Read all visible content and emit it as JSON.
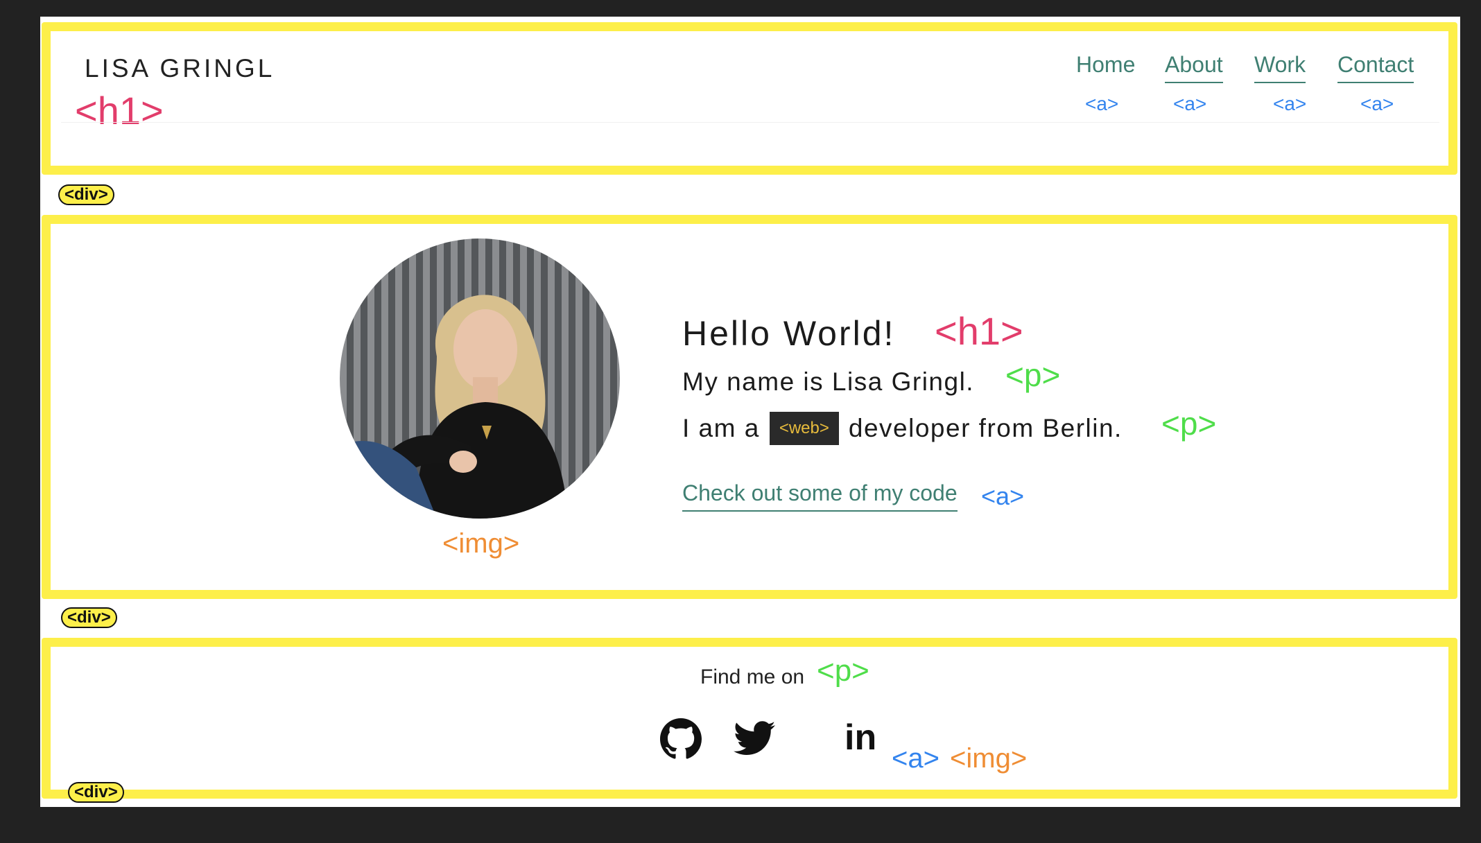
{
  "header": {
    "logo": "LISA GRINGL",
    "nav": [
      {
        "label": "Home"
      },
      {
        "label": "About"
      },
      {
        "label": "Work"
      },
      {
        "label": "Contact"
      }
    ]
  },
  "hero": {
    "heading": "Hello World!",
    "intro": "My name is Lisa Gringl.",
    "role_prefix": "I am a",
    "role_badge": "<web>",
    "role_suffix": "developer from Berlin.",
    "code_link": "Check out some of my code"
  },
  "footer": {
    "find_me": "Find me on",
    "social": [
      {
        "name": "github-icon"
      },
      {
        "name": "twitter-icon"
      },
      {
        "name": "linkedin-icon",
        "text": "in"
      }
    ]
  },
  "annotations": {
    "div": "<div>",
    "h1": "<h1>",
    "a": "<a>",
    "p": "<p>",
    "img": "<img>"
  },
  "colors": {
    "box": "#fdef4a",
    "h1_tag": "#e23d6b",
    "a_tag": "#3384ee",
    "p_tag": "#4fdd4a",
    "img_tag": "#ef8d34",
    "link": "#3f7f72"
  }
}
